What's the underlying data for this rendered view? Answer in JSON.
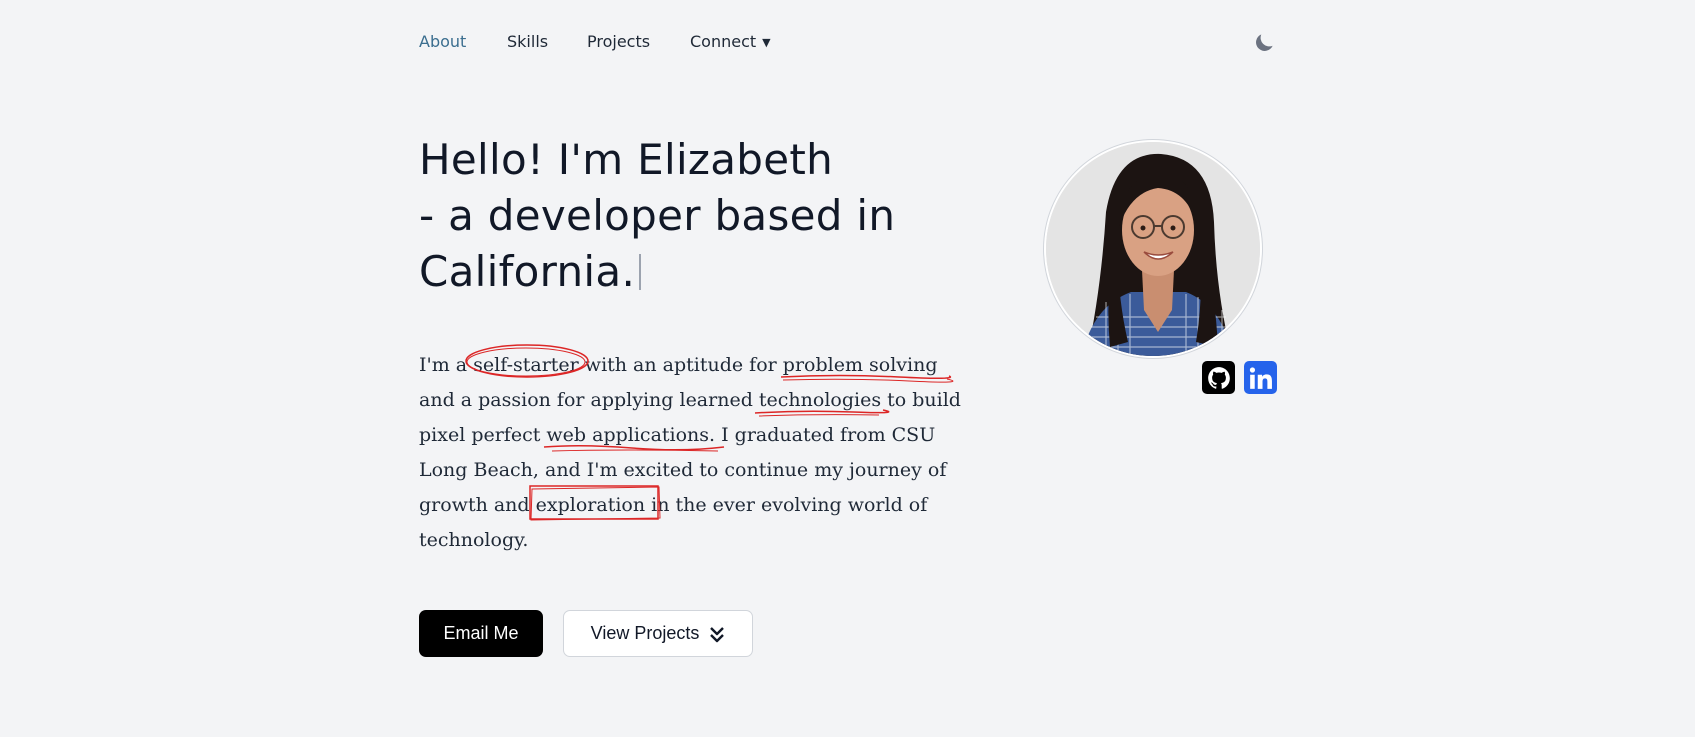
{
  "nav": {
    "items": [
      {
        "label": "About",
        "active": true
      },
      {
        "label": "Skills",
        "active": false
      },
      {
        "label": "Projects",
        "active": false
      },
      {
        "label": "Connect",
        "active": false
      }
    ],
    "theme_icon": "moon-icon"
  },
  "hero": {
    "headline_lines": [
      "Hello! I'm Elizabeth",
      "- a developer based in",
      "California."
    ],
    "bio": {
      "l1a": "I'm a ",
      "l1b": "self-starter",
      "l1c": " with an aptitude for ",
      "l1d": "problem solving",
      "l2a": "and a passion for applying learned ",
      "l2b": "technologies",
      "l2c": " to build",
      "l3a": "pixel perfect ",
      "l3b": "web applications",
      "l3c": ". I graduated from CSU",
      "l4": "Long Beach, and I'm excited to continue my journey of",
      "l5a": "growth and ",
      "l5b": "exploration",
      "l5c": " in the ever evolving world of",
      "l6": "technology."
    }
  },
  "buttons": {
    "email": "Email Me",
    "projects": "View Projects",
    "projects_icon": "double-chevron-down-icon"
  },
  "social": {
    "github_icon": "github-icon",
    "linkedin_icon": "linkedin-icon"
  },
  "colors": {
    "accent_nav": "#3b6e8f",
    "annotation_red": "#dc2626",
    "linkedin_blue": "#2563eb"
  }
}
